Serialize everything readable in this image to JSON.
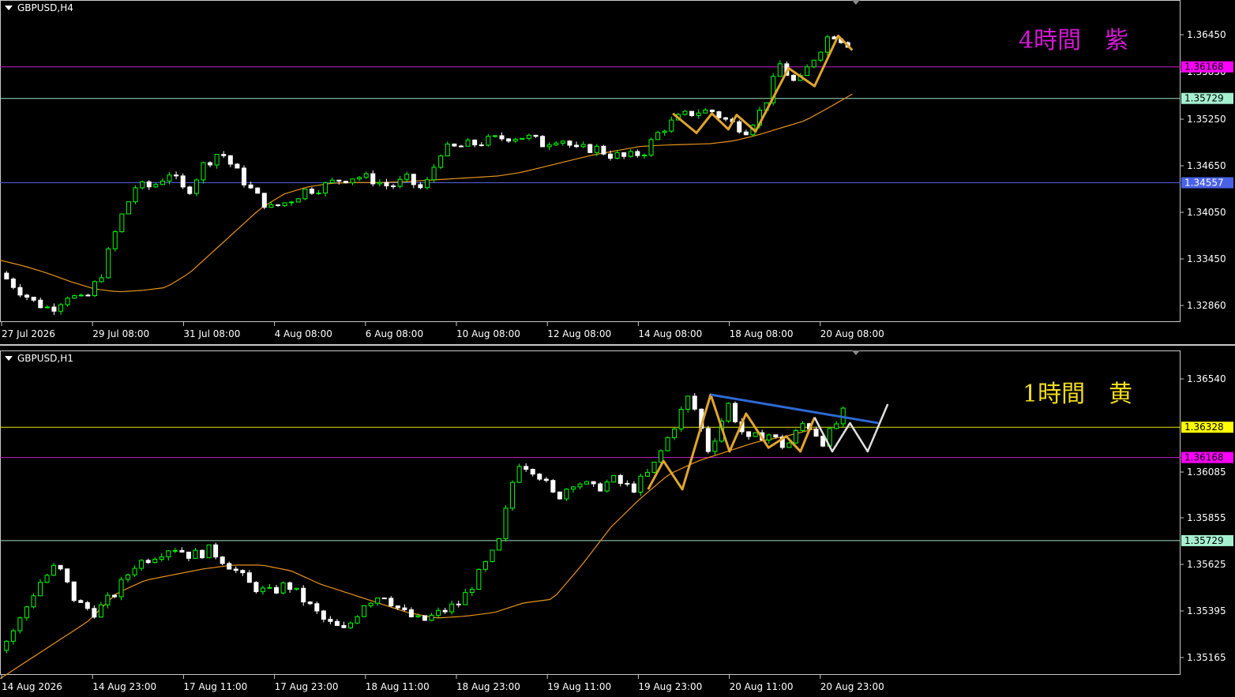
{
  "panels": [
    {
      "id": "h4",
      "symbol": "GBPUSD,H4",
      "label": "4時間　紫",
      "label_color": "#d21ad2",
      "price_min": 1.3262,
      "price_max": 1.3701,
      "y_ticks": [
        "1.36450",
        "1.35850",
        "1.35250",
        "1.34650",
        "1.34050",
        "1.33450",
        "1.32860"
      ],
      "x_ticks": [
        "27 Jul 2026",
        "29 Jul 08:00",
        "31 Jul 08:00",
        "4 Aug 08:00",
        "6 Aug 08:00",
        "10 Aug 08:00",
        "12 Aug 08:00",
        "14 Aug 08:00",
        "18 Aug 08:00",
        "20 Aug 08:00"
      ],
      "hlines": [
        {
          "price": 1.36168,
          "label": "1.36168",
          "color": "#c81ec8",
          "tag_bg": "#ff00ff",
          "tag_fg": "#000"
        },
        {
          "price": 1.35729,
          "label": "1.35729",
          "color": "#9fe0c4",
          "tag_bg": "#a6f0d0",
          "tag_fg": "#000"
        },
        {
          "price": 1.34557,
          "label": "1.34557",
          "color": "#5560e0",
          "tag_bg": "#4a62e8",
          "tag_fg": "#fff"
        }
      ],
      "anchors": [
        1.333,
        1.331,
        1.329,
        1.328,
        1.33,
        1.329,
        1.333,
        1.34,
        1.345,
        1.345,
        1.347,
        1.344,
        1.348,
        1.35,
        1.347,
        1.344,
        1.342,
        1.343,
        1.3445,
        1.345,
        1.346,
        1.3465,
        1.346,
        1.345,
        1.346,
        1.3445,
        1.35,
        1.3505,
        1.351,
        1.3515,
        1.352,
        1.352,
        1.351,
        1.352,
        1.35,
        1.3505,
        1.3495,
        1.349,
        1.35,
        1.353,
        1.3545,
        1.3555,
        1.3555,
        1.354,
        1.353,
        1.356,
        1.362,
        1.359,
        1.363,
        1.3665,
        1.365
      ],
      "ma": [
        1.3348,
        1.334,
        1.333,
        1.3318,
        1.3308,
        1.3304,
        1.3306,
        1.331,
        1.333,
        1.336,
        1.339,
        1.342,
        1.344,
        1.345,
        1.3455,
        1.3456,
        1.3456,
        1.3457,
        1.3459,
        1.3461,
        1.3463,
        1.3465,
        1.347,
        1.3478,
        1.3486,
        1.3494,
        1.35,
        1.3506,
        1.3508,
        1.3509,
        1.351,
        1.3514,
        1.3522,
        1.3532,
        1.3542,
        1.356,
        1.3579
      ],
      "zigzag": [
        [
          1.3552,
          0.57
        ],
        [
          1.3525,
          0.59
        ],
        [
          1.3552,
          0.603
        ],
        [
          1.353,
          0.617
        ],
        [
          1.355,
          0.624
        ],
        [
          1.3527,
          0.64
        ],
        [
          1.3615,
          0.668
        ],
        [
          1.359,
          0.69
        ],
        [
          1.366,
          0.71
        ],
        [
          1.364,
          0.722
        ]
      ],
      "ma_start_frac": 0.0,
      "ma_end_frac": 0.722
    },
    {
      "id": "h1",
      "symbol": "GBPUSD,H1",
      "label": "1時間　黄",
      "label_color": "#f2dc20",
      "price_min": 1.3502,
      "price_max": 1.367,
      "y_ticks": [
        "1.36540",
        "1.36085",
        "1.35855",
        "1.35625",
        "1.35395",
        "1.35165"
      ],
      "x_ticks": [
        "14 Aug 2026",
        "14 Aug 23:00",
        "17 Aug 11:00",
        "17 Aug 23:00",
        "18 Aug 11:00",
        "18 Aug 23:00",
        "19 Aug 11:00",
        "19 Aug 23:00",
        "20 Aug 11:00",
        "20 Aug 23:00"
      ],
      "hlines": [
        {
          "price": 1.36328,
          "label": "1.36328",
          "color": "#e6e600",
          "tag_bg": "#ffff00",
          "tag_fg": "#000"
        },
        {
          "price": 1.36168,
          "label": "1.36168",
          "color": "#c81ec8",
          "tag_bg": "#ff00ff",
          "tag_fg": "#000"
        },
        {
          "price": 1.35729,
          "label": "1.35729",
          "color": "#9fe0c4",
          "tag_bg": "#a6f0d0",
          "tag_fg": "#000"
        }
      ],
      "anchors": [
        1.3515,
        1.353,
        1.355,
        1.356,
        1.354,
        1.3535,
        1.3545,
        1.356,
        1.3565,
        1.357,
        1.3565,
        1.3568,
        1.356,
        1.355,
        1.3545,
        1.355,
        1.354,
        1.353,
        1.3525,
        1.354,
        1.3545,
        1.3535,
        1.353,
        1.3535,
        1.354,
        1.3555,
        1.357,
        1.3615,
        1.361,
        1.3595,
        1.3605,
        1.36,
        1.3605,
        1.36,
        1.361,
        1.363,
        1.365,
        1.362,
        1.3645,
        1.3625,
        1.363,
        1.3622,
        1.3636,
        1.3625,
        1.364
      ],
      "ma": [
        1.35,
        1.351,
        1.352,
        1.353,
        1.3545,
        1.3552,
        1.3555,
        1.3558,
        1.356,
        1.356,
        1.3557,
        1.355,
        1.3545,
        1.354,
        1.3535,
        1.3532,
        1.3533,
        1.3535,
        1.354,
        1.3542,
        1.356,
        1.358,
        1.3595,
        1.3608,
        1.3615,
        1.362,
        1.3625,
        1.3628,
        1.3632
      ],
      "zigzag": [
        [
          1.36,
          0.549
        ],
        [
          1.3615,
          0.562
        ],
        [
          1.36,
          0.578
        ],
        [
          1.365,
          0.602
        ],
        [
          1.362,
          0.618
        ],
        [
          1.364,
          0.632
        ],
        [
          1.3622,
          0.651
        ],
        [
          1.3628,
          0.666
        ],
        [
          1.362,
          0.678
        ],
        [
          1.3638,
          0.69
        ]
      ],
      "trendline": [
        [
          1.365,
          0.602
        ],
        [
          1.3635,
          0.744
        ]
      ],
      "projection": [
        [
          1.3638,
          0.69
        ],
        [
          1.362,
          0.705
        ],
        [
          1.3635,
          0.72
        ],
        [
          1.362,
          0.735
        ],
        [
          1.3645,
          0.752
        ]
      ],
      "ma_start_frac": 0.0,
      "ma_end_frac": 0.69
    }
  ],
  "colors": {
    "bull": "#00ff00",
    "bear": "#ffffff",
    "ma": "#e8931c",
    "zigzag": "#e1a52e",
    "trend": "#2e69d4",
    "projection": "#e0e0e0",
    "axis": "#c8c8c8"
  }
}
